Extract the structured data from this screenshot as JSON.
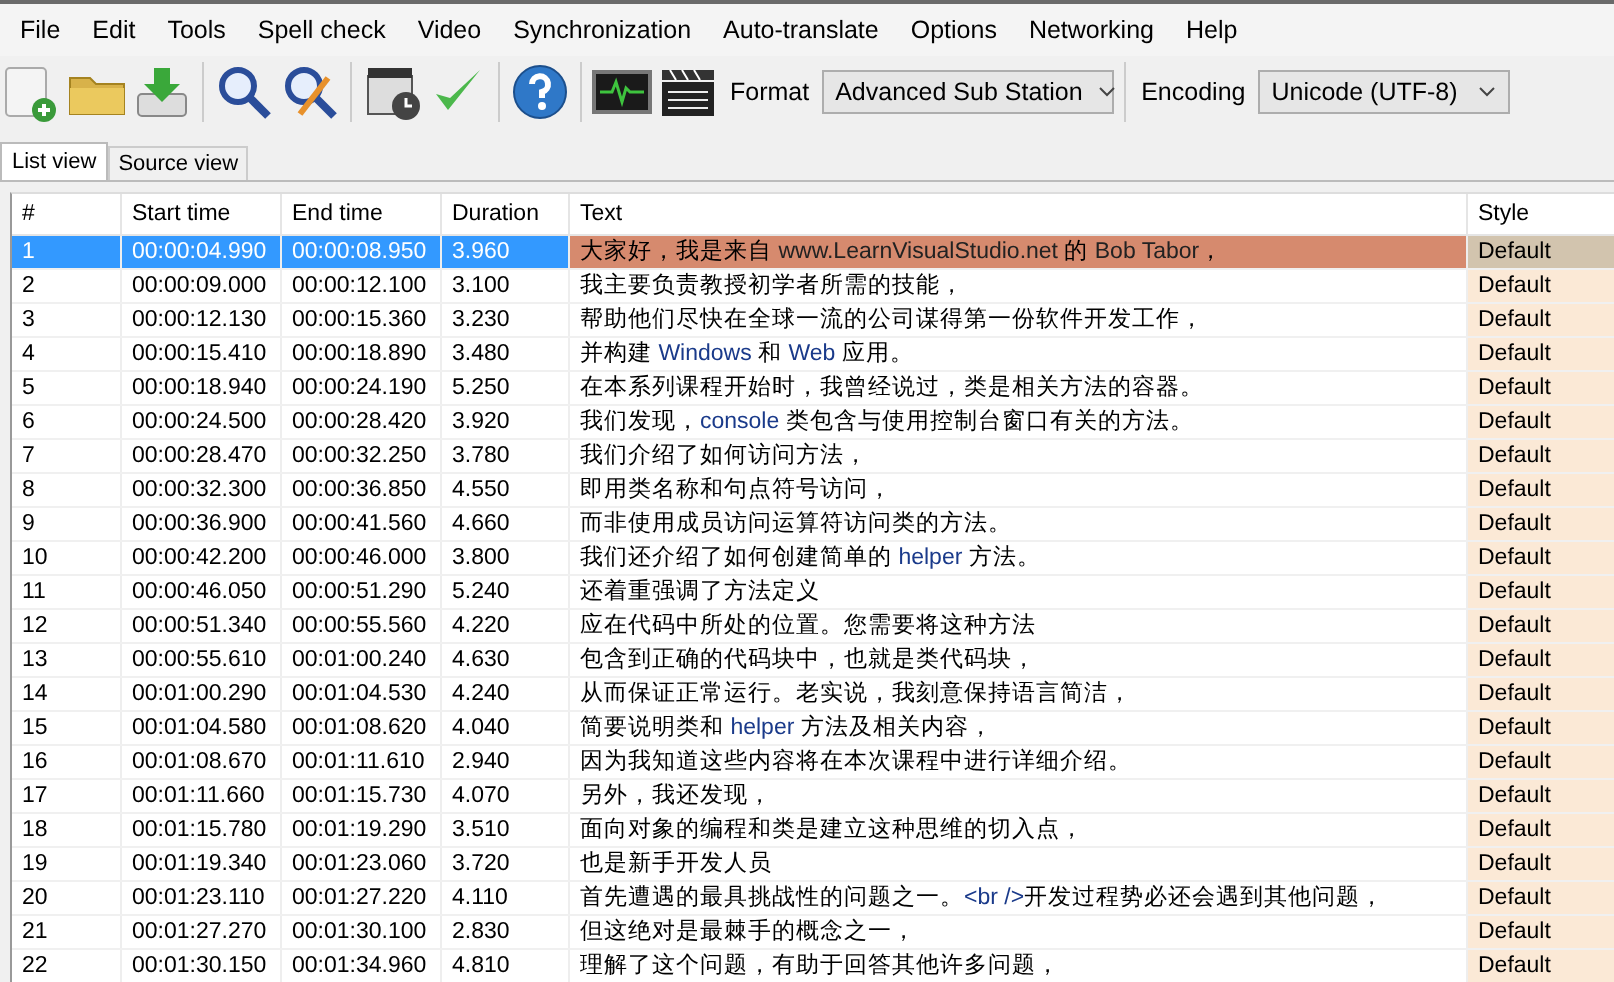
{
  "menu": [
    "File",
    "Edit",
    "Tools",
    "Spell check",
    "Video",
    "Synchronization",
    "Auto-translate",
    "Options",
    "Networking",
    "Help"
  ],
  "toolbar": {
    "format_label": "Format",
    "format_value": "Advanced Sub Station",
    "encoding_label": "Encoding",
    "encoding_value": "Unicode (UTF-8)"
  },
  "tabs": [
    {
      "label": "List view",
      "selected": true
    },
    {
      "label": "Source view",
      "selected": false
    }
  ],
  "table": {
    "columns": [
      "#",
      "Start time",
      "End time",
      "Duration",
      "Text",
      "Style"
    ],
    "rows": [
      {
        "number": "1",
        "start": "00:00:04.990",
        "end": "00:00:08.950",
        "duration": "3.960",
        "text": [
          {
            "kind": "cjk",
            "text": "大家好，我是来自 "
          },
          {
            "kind": "latin",
            "text": "www.LearnVisualStudio.net"
          },
          {
            "kind": "cjk",
            "text": " 的 "
          },
          {
            "kind": "latin",
            "text": "Bob Tabor"
          },
          {
            "kind": "cjk",
            "text": "，"
          }
        ],
        "style": "Default",
        "selected": true
      },
      {
        "number": "2",
        "start": "00:00:09.000",
        "end": "00:00:12.100",
        "duration": "3.100",
        "text": [
          {
            "kind": "cjk",
            "text": "我主要负责教授初学者所需的技能，"
          }
        ],
        "style": "Default",
        "selected": false
      },
      {
        "number": "3",
        "start": "00:00:12.130",
        "end": "00:00:15.360",
        "duration": "3.230",
        "text": [
          {
            "kind": "cjk",
            "text": "帮助他们尽快在全球一流的公司谋得第一份软件开发工作，"
          }
        ],
        "style": "Default",
        "selected": false
      },
      {
        "number": "4",
        "start": "00:00:15.410",
        "end": "00:00:18.890",
        "duration": "3.480",
        "text": [
          {
            "kind": "cjk",
            "text": "并构建 "
          },
          {
            "kind": "latin",
            "text": "Windows"
          },
          {
            "kind": "cjk",
            "text": " 和 "
          },
          {
            "kind": "latin",
            "text": "Web"
          },
          {
            "kind": "cjk",
            "text": " 应用。"
          }
        ],
        "style": "Default",
        "selected": false
      },
      {
        "number": "5",
        "start": "00:00:18.940",
        "end": "00:00:24.190",
        "duration": "5.250",
        "text": [
          {
            "kind": "cjk",
            "text": "在本系列课程开始时，我曾经说过，类是相关方法的容器。"
          }
        ],
        "style": "Default",
        "selected": false
      },
      {
        "number": "6",
        "start": "00:00:24.500",
        "end": "00:00:28.420",
        "duration": "3.920",
        "text": [
          {
            "kind": "cjk",
            "text": "我们发现，"
          },
          {
            "kind": "latin",
            "text": "console"
          },
          {
            "kind": "cjk",
            "text": " 类包含与使用控制台窗口有关的方法。"
          }
        ],
        "style": "Default",
        "selected": false
      },
      {
        "number": "7",
        "start": "00:00:28.470",
        "end": "00:00:32.250",
        "duration": "3.780",
        "text": [
          {
            "kind": "cjk",
            "text": "我们介绍了如何访问方法，"
          }
        ],
        "style": "Default",
        "selected": false
      },
      {
        "number": "8",
        "start": "00:00:32.300",
        "end": "00:00:36.850",
        "duration": "4.550",
        "text": [
          {
            "kind": "cjk",
            "text": "即用类名称和句点符号访问，"
          }
        ],
        "style": "Default",
        "selected": false
      },
      {
        "number": "9",
        "start": "00:00:36.900",
        "end": "00:00:41.560",
        "duration": "4.660",
        "text": [
          {
            "kind": "cjk",
            "text": "而非使用成员访问运算符访问类的方法。"
          }
        ],
        "style": "Default",
        "selected": false
      },
      {
        "number": "10",
        "start": "00:00:42.200",
        "end": "00:00:46.000",
        "duration": "3.800",
        "text": [
          {
            "kind": "cjk",
            "text": "我们还介绍了如何创建简单的 "
          },
          {
            "kind": "latin",
            "text": "helper"
          },
          {
            "kind": "cjk",
            "text": " 方法。"
          }
        ],
        "style": "Default",
        "selected": false
      },
      {
        "number": "11",
        "start": "00:00:46.050",
        "end": "00:00:51.290",
        "duration": "5.240",
        "text": [
          {
            "kind": "cjk",
            "text": "还着重强调了方法定义"
          }
        ],
        "style": "Default",
        "selected": false
      },
      {
        "number": "12",
        "start": "00:00:51.340",
        "end": "00:00:55.560",
        "duration": "4.220",
        "text": [
          {
            "kind": "cjk",
            "text": "应在代码中所处的位置。您需要将这种方法"
          }
        ],
        "style": "Default",
        "selected": false
      },
      {
        "number": "13",
        "start": "00:00:55.610",
        "end": "00:01:00.240",
        "duration": "4.630",
        "text": [
          {
            "kind": "cjk",
            "text": "包含到正确的代码块中，也就是类代码块，"
          }
        ],
        "style": "Default",
        "selected": false
      },
      {
        "number": "14",
        "start": "00:01:00.290",
        "end": "00:01:04.530",
        "duration": "4.240",
        "text": [
          {
            "kind": "cjk",
            "text": "从而保证正常运行。老实说，我刻意保持语言简洁，"
          }
        ],
        "style": "Default",
        "selected": false
      },
      {
        "number": "15",
        "start": "00:01:04.580",
        "end": "00:01:08.620",
        "duration": "4.040",
        "text": [
          {
            "kind": "cjk",
            "text": "简要说明类和 "
          },
          {
            "kind": "latin",
            "text": "helper"
          },
          {
            "kind": "cjk",
            "text": " 方法及相关内容，"
          }
        ],
        "style": "Default",
        "selected": false
      },
      {
        "number": "16",
        "start": "00:01:08.670",
        "end": "00:01:11.610",
        "duration": "2.940",
        "text": [
          {
            "kind": "cjk",
            "text": "因为我知道这些内容将在本次课程中进行详细介绍。"
          }
        ],
        "style": "Default",
        "selected": false
      },
      {
        "number": "17",
        "start": "00:01:11.660",
        "end": "00:01:15.730",
        "duration": "4.070",
        "text": [
          {
            "kind": "cjk",
            "text": "另外，我还发现，"
          }
        ],
        "style": "Default",
        "selected": false
      },
      {
        "number": "18",
        "start": "00:01:15.780",
        "end": "00:01:19.290",
        "duration": "3.510",
        "text": [
          {
            "kind": "cjk",
            "text": "面向对象的编程和类是建立这种思维的切入点，"
          }
        ],
        "style": "Default",
        "selected": false
      },
      {
        "number": "19",
        "start": "00:01:19.340",
        "end": "00:01:23.060",
        "duration": "3.720",
        "text": [
          {
            "kind": "cjk",
            "text": "也是新手开发人员"
          }
        ],
        "style": "Default",
        "selected": false
      },
      {
        "number": "20",
        "start": "00:01:23.110",
        "end": "00:01:27.220",
        "duration": "4.110",
        "text": [
          {
            "kind": "cjk",
            "text": "首先遭遇的最具挑战性的问题之一。"
          },
          {
            "kind": "latin",
            "text": "<br />"
          },
          {
            "kind": "cjk",
            "text": "开发过程势必还会遇到其他问题，"
          }
        ],
        "style": "Default",
        "selected": false
      },
      {
        "number": "21",
        "start": "00:01:27.270",
        "end": "00:01:30.100",
        "duration": "2.830",
        "text": [
          {
            "kind": "cjk",
            "text": "但这绝对是最棘手的概念之一，"
          }
        ],
        "style": "Default",
        "selected": false
      },
      {
        "number": "22",
        "start": "00:01:30.150",
        "end": "00:01:34.960",
        "duration": "4.810",
        "text": [
          {
            "kind": "cjk",
            "text": "理解了这个问题，有助于回答其他许多问题，"
          }
        ],
        "style": "Default",
        "selected": false
      }
    ]
  }
}
